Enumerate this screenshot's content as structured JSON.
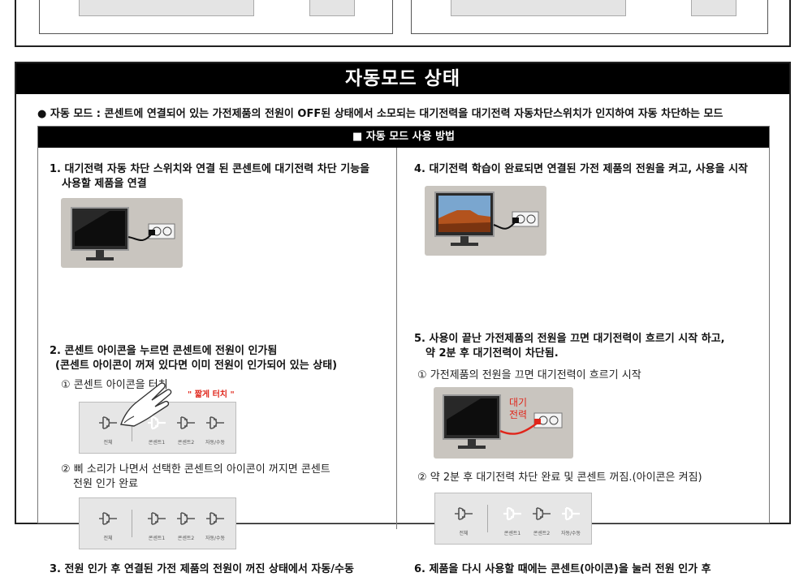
{
  "section_title": "자동모드 상태",
  "intro": "● 자동 모드 : 콘센트에 연결되어 있는 가전제품의 전원이 OFF된 상태에서 소모되는 대기전력을 대기전력 자동차단스위치가 인지하여 자동 차단하는 모드",
  "howto_title": "■ 자동 모드 사용 방법",
  "steps": {
    "s1_line1": "1. 대기전력 자동 차단 스위치와  연결 된 콘센트에 대기전력 차단 기능을",
    "s1_line2": "사용할 제품을 연결",
    "s2_line1": "2. 콘센트 아이콘을 누르면 콘센트에 전원이 인가됨",
    "s2_line2": "(콘센트 아이콘이 꺼져 있다면 이미 전원이 인가되어 있는 상태)",
    "s2_sub1": "① 콘센트 아이콘을 터치",
    "s2_touch_note": "\" 짧게 터치 \"",
    "s2_sub2_line1": "② 삐 소리가 나면서 선택한 콘센트의 아이콘이 꺼지면 콘센트",
    "s2_sub2_line2": "전원 인가  완료",
    "s3_line1": "3. 전원 인가 후 연결된 가전 제품의 전원이 꺼진 상태에서  자동/수동",
    "s4_line1": "4. 대기전력 학습이 완료되면 연결된 가전 제품의 전원을 켜고, 사용을 시작",
    "s5_line1": "5. 사용이 끝난 가전제품의 전원을 끄면 대기전력이 흐르기 시작 하고,",
    "s5_line2": "약  2분 후 대기전력이 차단됨.",
    "s5_sub1": "① 가전제품의 전원을 끄면 대기전력이 흐르기 시작",
    "s5_standby": [
      "대기",
      "전력"
    ],
    "s5_sub2": "② 약  2분 후 대기전력 차단 완료 및 콘센트  꺼짐.(아이콘은 켜짐)",
    "s6_line1": "6. 제품을 다시 사용할 때에는 콘센트(아이콘)을 눌러 전원 인가  후"
  },
  "panel_labels": [
    "전체",
    "콘센트1",
    "콘센트2",
    "자동/수동"
  ],
  "colors": {
    "accent_red": "#e0261b",
    "header_bg": "#000000"
  }
}
